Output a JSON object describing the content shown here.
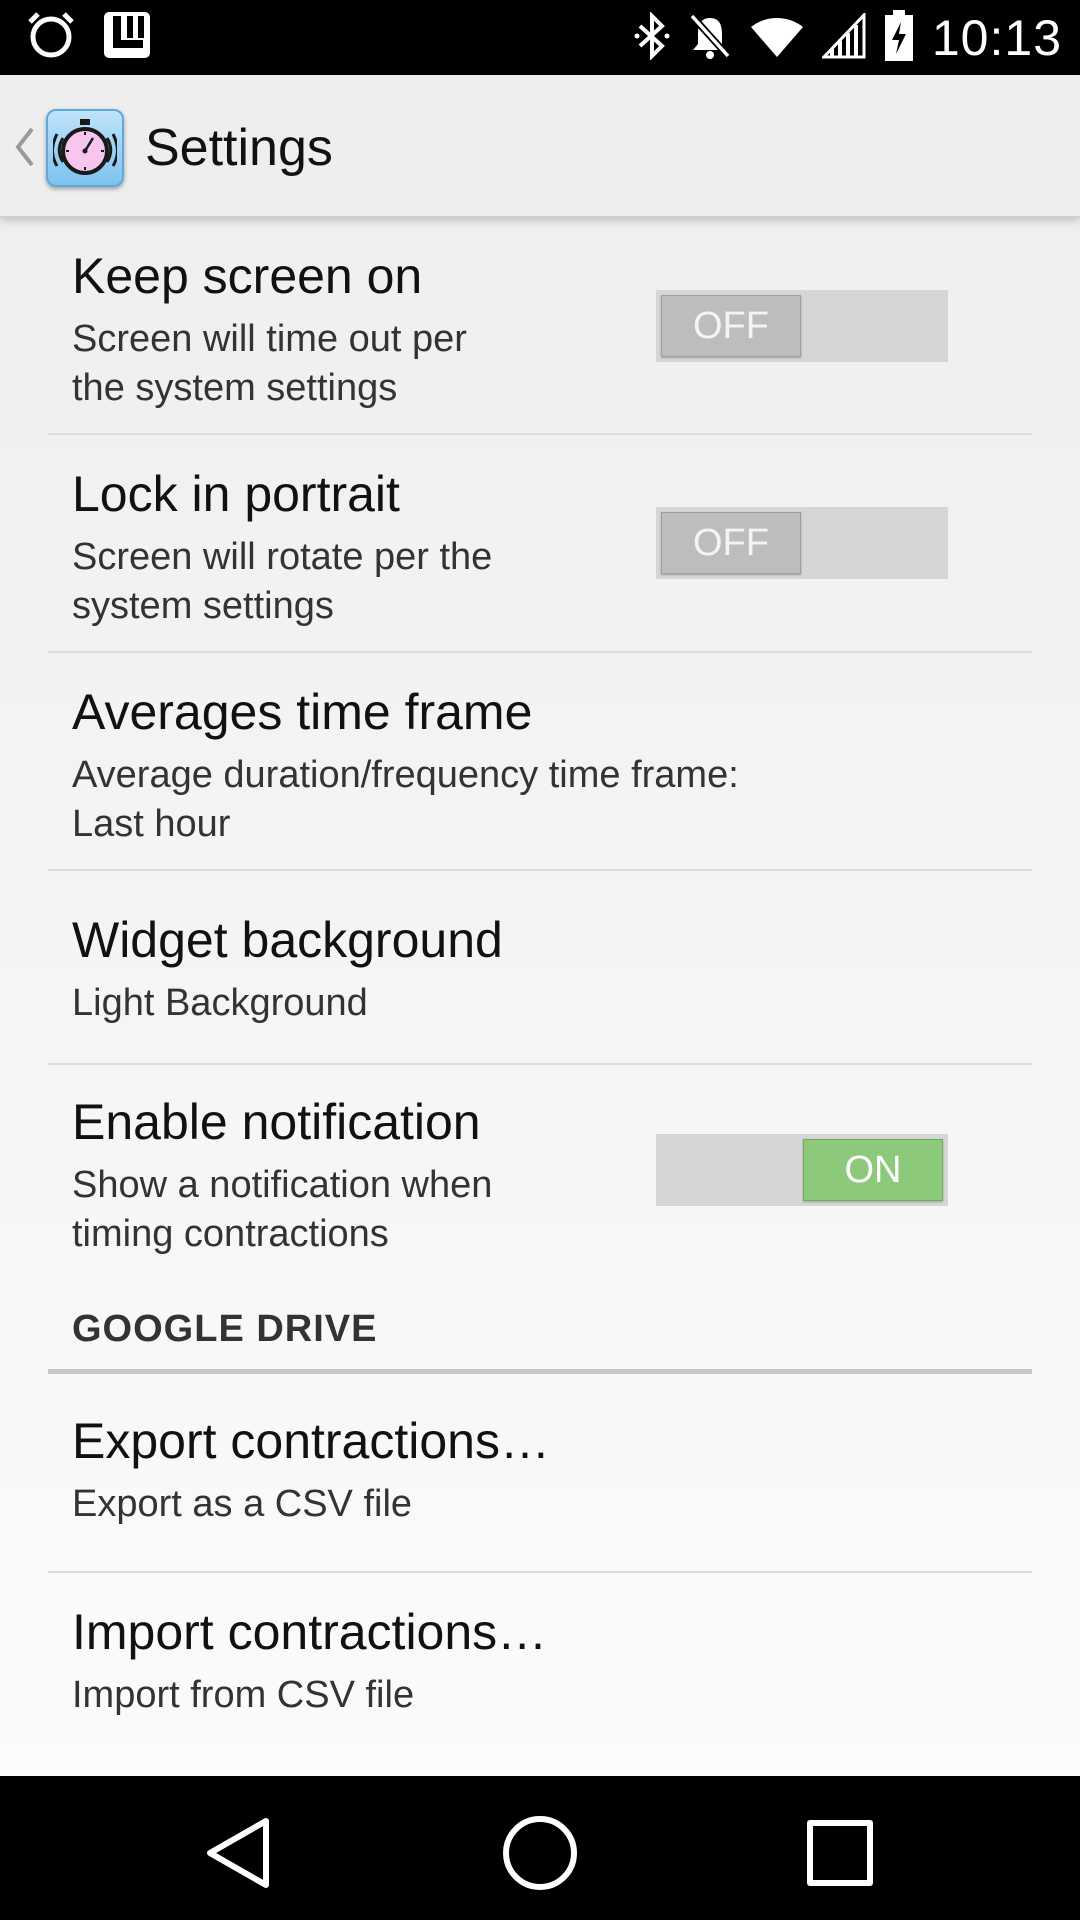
{
  "status_bar": {
    "time": "10:13",
    "icons": [
      "alarm-icon",
      "app-notification-icon",
      "bluetooth-icon",
      "notifications-muted-icon",
      "wifi-icon",
      "cell-signal-icon",
      "battery-charging-icon"
    ]
  },
  "action_bar": {
    "title": "Settings",
    "app_icon": "stopwatch-icon"
  },
  "preferences": [
    {
      "title": "Keep screen on",
      "summary": "Screen will time out per\nthe system settings",
      "toggle": "OFF"
    },
    {
      "title": "Lock in portrait",
      "summary": "Screen will rotate per the\nsystem settings",
      "toggle": "OFF"
    },
    {
      "title": "Averages time frame",
      "summary": "Average duration/frequency time frame:\nLast hour"
    },
    {
      "title": "Widget background",
      "summary": "Light Background"
    },
    {
      "title": "Enable notification",
      "summary": "Show a notification when\ntiming contractions",
      "toggle": "ON"
    }
  ],
  "category": {
    "title": "GOOGLE DRIVE"
  },
  "drive_preferences": [
    {
      "title": "Export contractions…",
      "summary": "Export as a CSV file"
    },
    {
      "title": "Import contractions…",
      "summary": "Import from CSV file"
    }
  ],
  "colors": {
    "toggle_on": "#8cc97a",
    "toggle_off": "#bdbdbd",
    "app_icon_blue": "#7cc3f0"
  },
  "nav_bar": {
    "icons": [
      "back-icon",
      "home-icon",
      "recents-icon"
    ]
  }
}
